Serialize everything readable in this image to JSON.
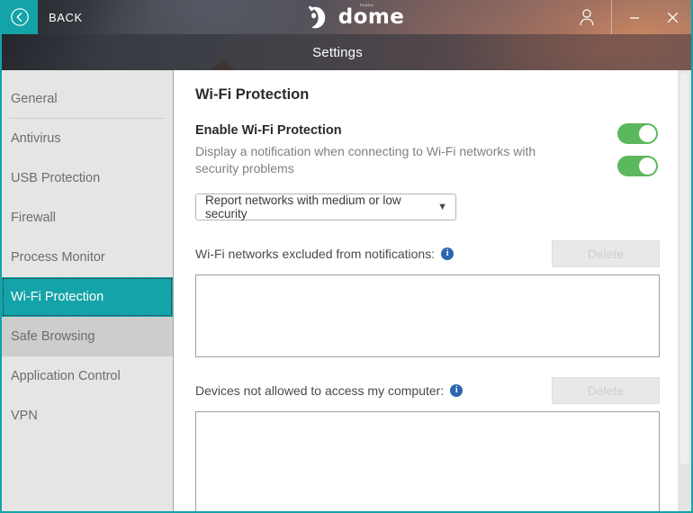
{
  "titlebar": {
    "back_label": "BACK",
    "brand_supertext": "PANDA",
    "brand_word": "dome",
    "account_icon": "user-icon",
    "minimize_label": "–",
    "close_label": "✕"
  },
  "subheader": {
    "title": "Settings"
  },
  "sidebar": {
    "items": [
      {
        "label": "General",
        "state": "normal",
        "divider_below": true
      },
      {
        "label": "Antivirus",
        "state": "normal",
        "divider_below": false
      },
      {
        "label": "USB Protection",
        "state": "normal",
        "divider_below": false
      },
      {
        "label": "Firewall",
        "state": "normal",
        "divider_below": false
      },
      {
        "label": "Process Monitor",
        "state": "normal",
        "divider_below": false
      },
      {
        "label": "Wi-Fi Protection",
        "state": "selected",
        "divider_below": false
      },
      {
        "label": "Safe Browsing",
        "state": "hovered",
        "divider_below": false
      },
      {
        "label": "Application Control",
        "state": "normal",
        "divider_below": false
      },
      {
        "label": "VPN",
        "state": "normal",
        "divider_below": false
      }
    ]
  },
  "content": {
    "page_title": "Wi-Fi Protection",
    "enable_setting": {
      "label": "Enable Wi-Fi Protection",
      "toggle_state": "on"
    },
    "notify_setting": {
      "description": "Display a notification when connecting to Wi-Fi networks with security problems",
      "toggle_state": "on"
    },
    "security_level_select": {
      "selected": "Report networks with medium or low security",
      "caret": "▼",
      "options": [
        "Report networks with medium or low security"
      ]
    },
    "excluded_networks": {
      "label": "Wi-Fi networks excluded from notifications:",
      "info_icon": "info-icon",
      "info_glyph": "i",
      "delete_label": "Delete",
      "delete_enabled": false,
      "items": []
    },
    "blocked_devices": {
      "label": "Devices not allowed to access my computer:",
      "info_icon": "info-icon",
      "info_glyph": "i",
      "delete_label": "Delete",
      "delete_enabled": false,
      "items": []
    }
  },
  "colors": {
    "accent_teal": "#14a3a8",
    "toggle_green": "#5cb85c",
    "info_blue": "#2b66b0",
    "sidebar_bg": "#e5e5e5",
    "sidebar_hover": "#cdcdcd"
  }
}
